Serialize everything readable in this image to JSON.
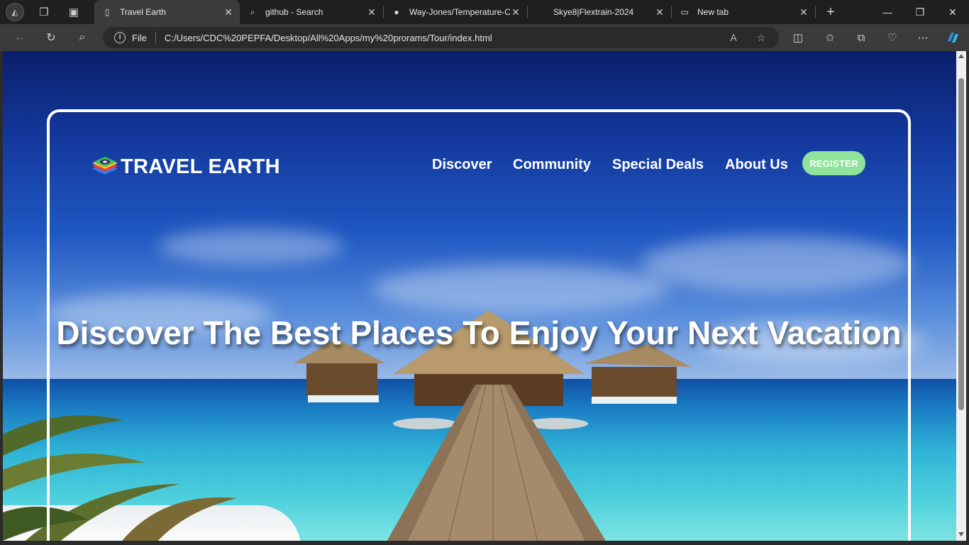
{
  "browser": {
    "tabs": [
      {
        "title": "Travel Earth",
        "icon": "page-icon"
      },
      {
        "title": "github - Search",
        "icon": "search-icon"
      },
      {
        "title": "Way-Jones/Temperature-C",
        "icon": "github-icon"
      },
      {
        "title": "Skye8|Flextrain-2024",
        "icon": "page-icon"
      },
      {
        "title": "New tab",
        "icon": "newtab-icon"
      }
    ],
    "address": {
      "scheme_label": "File",
      "url": "C:/Users/CDC%20PEPFA/Desktop/All%20Apps/my%20prorams/Tour/index.html"
    }
  },
  "page": {
    "logo_text": "TRAVEL EARTH",
    "nav": {
      "discover": "Discover",
      "community": "Community",
      "special_deals": "Special Deals",
      "about_us": "About Us",
      "register": "REGISTER"
    },
    "hero_title": "Discover The Best Places To Enjoy Your Next Vacation"
  },
  "colors": {
    "register_bg": "#8fe39a",
    "card_border": "#ffffff",
    "sky_dark": "#0a1f6a",
    "sea": "#2fb3d6"
  }
}
